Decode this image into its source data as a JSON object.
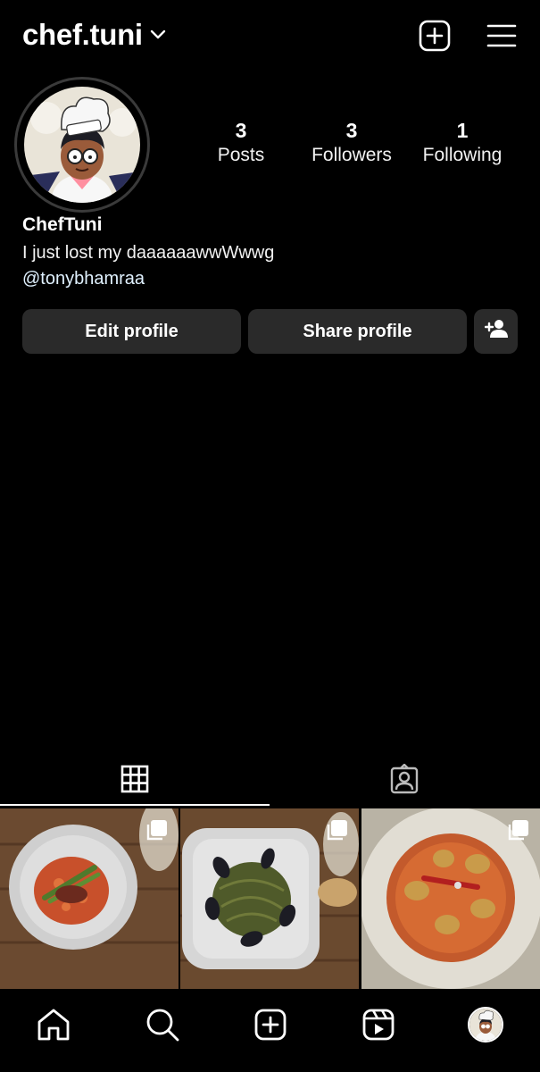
{
  "header": {
    "username": "chef.tuni"
  },
  "profile": {
    "stats": [
      {
        "num": "3",
        "label": "Posts"
      },
      {
        "num": "3",
        "label": "Followers"
      },
      {
        "num": "1",
        "label": "Following"
      }
    ],
    "display_name": "ChefTuni",
    "bio": "I just lost my daaaaaawwWwwg",
    "link": "@tonybhamraa"
  },
  "actions": {
    "edit": "Edit profile",
    "share": "Share profile"
  },
  "icons": {
    "header": [
      "chevron-down-icon",
      "create-post-icon",
      "menu-icon"
    ],
    "tabs": [
      "grid-icon",
      "tagged-icon"
    ],
    "nav": [
      "home-icon",
      "search-icon",
      "create-icon",
      "reels-icon",
      "profile-avatar"
    ],
    "post_badge": "multiple-photos-icon"
  },
  "colors": {
    "background": "#000000",
    "button": "#2a2a2a",
    "text": "#ffffff",
    "link": "#e0f1ff"
  }
}
